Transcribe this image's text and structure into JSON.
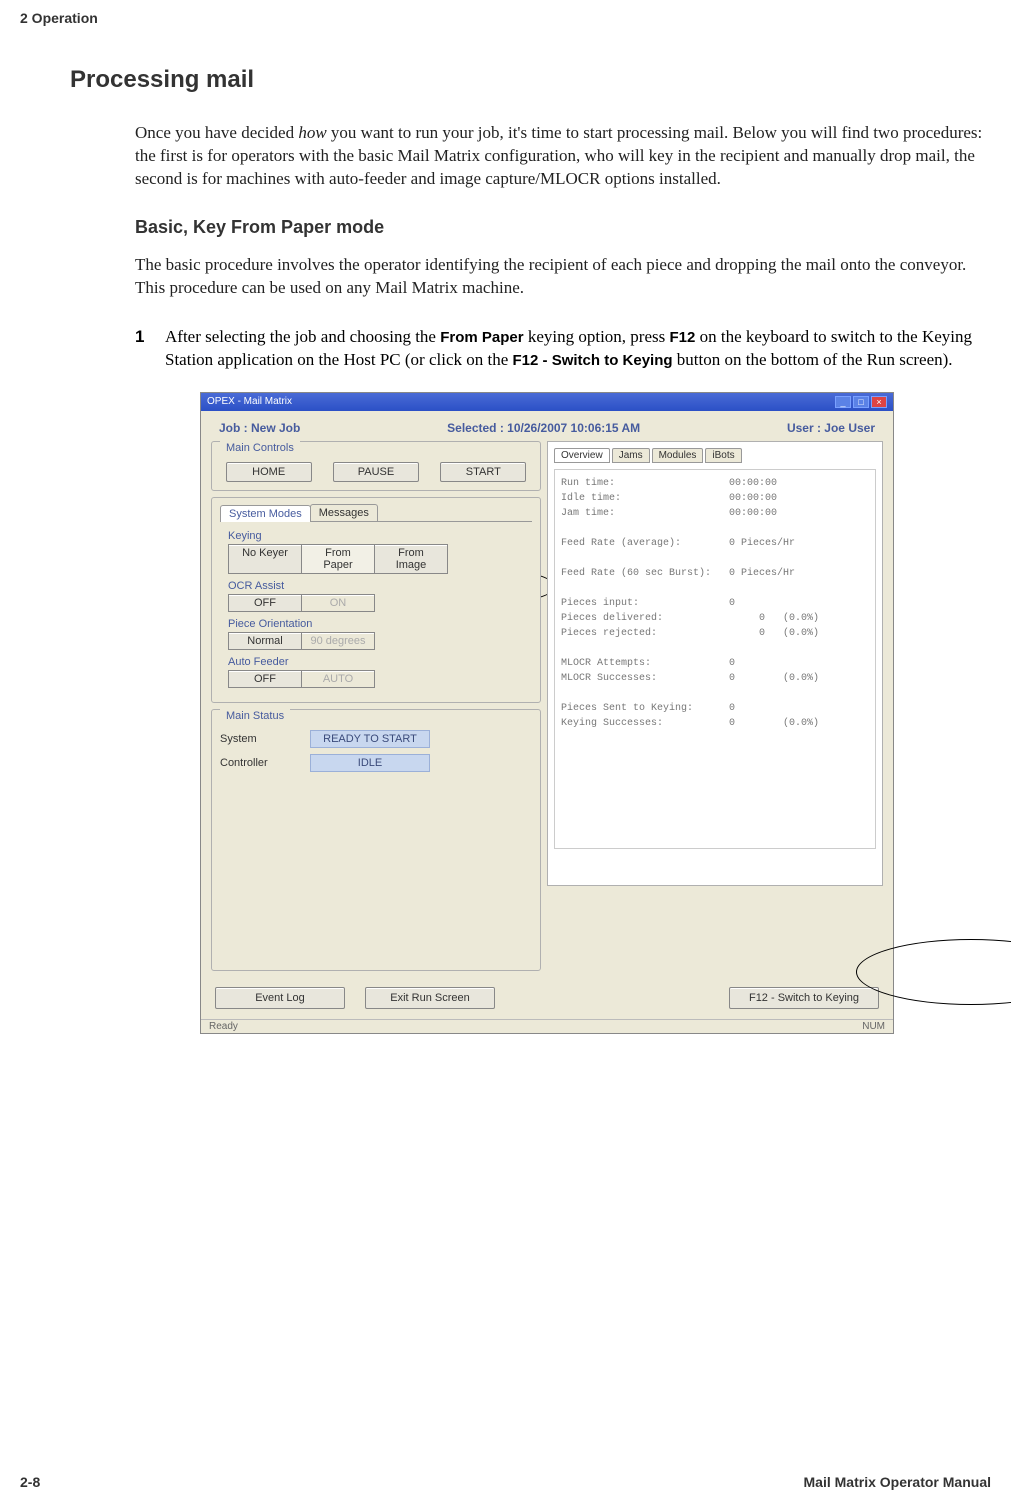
{
  "doc": {
    "header_section": "2  Operation",
    "title": "Processing mail",
    "intro_before_em": "Once you have decided ",
    "intro_em": "how",
    "intro_after_em": " you want to run your job, it's time to start processing mail. Below you will find two procedures: the first is for operators with the basic Mail Matrix configuration, who will key in the recipient and manually drop mail, the second is for machines with auto-feeder and image capture/MLOCR options installed.",
    "sub_title": "Basic, Key From Paper mode",
    "sub_para": "The basic procedure involves the operator identifying the recipient of each piece and dropping the mail onto the conveyor. This procedure can be used on any Mail Matrix machine.",
    "step_num": "1",
    "step_a": "After selecting the job and choosing the ",
    "step_b": "From Paper",
    "step_c": " keying option, press ",
    "step_d": "F12",
    "step_e": " on the keyboard to switch to the Keying Station application on the Host PC (or click on the ",
    "step_f": "F12 - Switch to Keying",
    "step_g": " button on the bottom of the Run screen).",
    "footer_left": "2-8",
    "footer_right": "Mail Matrix Operator Manual"
  },
  "app": {
    "titlebar": "OPEX - Mail Matrix",
    "tb_min": "_",
    "tb_max": "□",
    "tb_close": "×",
    "job": "Job : New Job",
    "selected": "Selected : 10/26/2007 10:06:15 AM",
    "user": "User : Joe User",
    "groups": {
      "main_controls": {
        "title": "Main Controls",
        "home": "HOME",
        "pause": "PAUSE",
        "start": "START"
      },
      "system_modes": {
        "tab1": "System Modes",
        "tab2": "Messages",
        "keying_label": "Keying",
        "keying_opts": {
          "a": "No Keyer",
          "b": "From Paper",
          "c": "From Image"
        },
        "ocr_label": "OCR Assist",
        "ocr_opts": {
          "a": "OFF",
          "b": "ON"
        },
        "piece_label": "Piece Orientation",
        "piece_opts": {
          "a": "Normal",
          "b": "90 degrees"
        },
        "feeder_label": "Auto Feeder",
        "feeder_opts": {
          "a": "OFF",
          "b": "AUTO"
        }
      },
      "main_status": {
        "title": "Main Status",
        "sys_label": "System",
        "sys_val": "READY TO START",
        "ctl_label": "Controller",
        "ctl_val": "IDLE"
      }
    },
    "right_tabs": {
      "a": "Overview",
      "b": "Jams",
      "c": "Modules",
      "d": "iBots"
    },
    "stats": "Run time:                   00:00:00\nIdle time:                  00:00:00\nJam time:                   00:00:00\n\nFeed Rate (average):        0 Pieces/Hr\n\nFeed Rate (60 sec Burst):   0 Pieces/Hr\n\nPieces input:               0\nPieces delivered:                0   (0.0%)\nPieces rejected:                 0   (0.0%)\n\nMLOCR Attempts:             0\nMLOCR Successes:            0        (0.0%)\n\nPieces Sent to Keying:      0\nKeying Successes:           0        (0.0%)",
    "bottom": {
      "event_log": "Event Log",
      "exit": "Exit Run Screen",
      "switch": "F12 - Switch to Keying"
    },
    "status_left": "Ready",
    "status_right": "NUM"
  }
}
